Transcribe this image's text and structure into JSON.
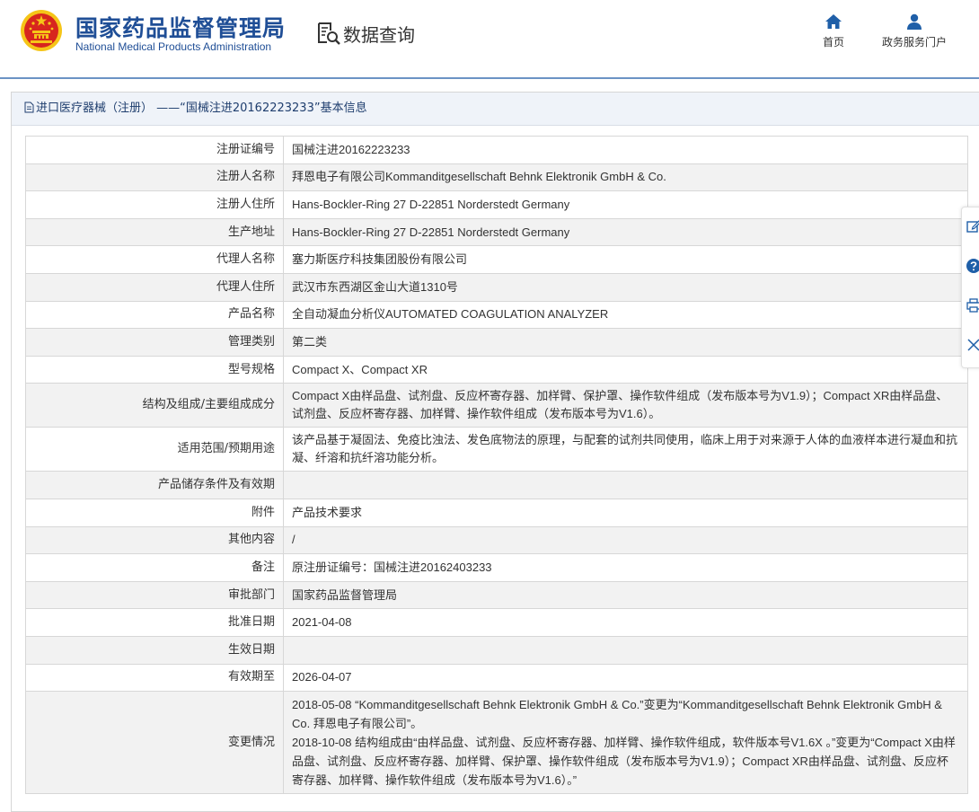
{
  "header": {
    "brand_cn": "国家药品监督管理局",
    "brand_en": "National Medical Products Administration",
    "data_query_label": "数据查询",
    "nav": [
      {
        "label": "首页",
        "icon": "home-icon"
      },
      {
        "label": "政务服务门户",
        "icon": "user-icon"
      }
    ]
  },
  "panel": {
    "title": "进口医疗器械（注册） ——“国械注进20162223233”基本信息"
  },
  "rows": [
    {
      "label": "注册证编号",
      "value": "国械注进20162223233"
    },
    {
      "label": "注册人名称",
      "value": "拜恩电子有限公司Kommanditgesellschaft Behnk Elektronik GmbH & Co."
    },
    {
      "label": "注册人住所",
      "value": "Hans-Bockler-Ring 27 D-22851 Norderstedt Germany"
    },
    {
      "label": "生产地址",
      "value": "Hans-Bockler-Ring 27 D-22851 Norderstedt Germany"
    },
    {
      "label": "代理人名称",
      "value": "塞力斯医疗科技集团股份有限公司"
    },
    {
      "label": "代理人住所",
      "value": "武汉市东西湖区金山大道1310号"
    },
    {
      "label": "产品名称",
      "value": "全自动凝血分析仪AUTOMATED COAGULATION ANALYZER"
    },
    {
      "label": "管理类别",
      "value": "第二类"
    },
    {
      "label": "型号规格",
      "value": "Compact X、Compact XR"
    },
    {
      "label": "结构及组成/主要组成成分",
      "value": "Compact X由样品盘、试剂盘、反应杯寄存器、加样臂、保护罩、操作软件组成（发布版本号为V1.9）；Compact XR由样品盘、试剂盘、反应杯寄存器、加样臂、操作软件组成（发布版本号为V1.6）。"
    },
    {
      "label": "适用范围/预期用途",
      "value": "该产品基于凝固法、免疫比浊法、发色底物法的原理，与配套的试剂共同使用，临床上用于对来源于人体的血液样本进行凝血和抗凝、纤溶和抗纤溶功能分析。"
    },
    {
      "label": "产品储存条件及有效期",
      "value": ""
    },
    {
      "label": "附件",
      "value": "产品技术要求"
    },
    {
      "label": "其他内容",
      "value": "/"
    },
    {
      "label": "备注",
      "value": "原注册证编号：国械注进20162403233"
    },
    {
      "label": "审批部门",
      "value": "国家药品监督管理局"
    },
    {
      "label": "批准日期",
      "value": "2021-04-08"
    },
    {
      "label": "生效日期",
      "value": ""
    },
    {
      "label": "有效期至",
      "value": "2026-04-07"
    }
  ],
  "change": {
    "label": "变更情况",
    "lines": [
      "2018-05-08 “Kommanditgesellschaft Behnk Elektronik GmbH & Co.”变更为“Kommanditgesellschaft Behnk Elektronik GmbH & Co. 拜恩电子有限公司”。",
      "2018-10-08 结构组成由“由样品盘、试剂盘、反应杯寄存器、加样臂、操作软件组成，软件版本号V1.6X 。”变更为“Compact X由样品盘、试剂盘、反应杯寄存器、加样臂、保护罩、操作软件组成（发布版本号为V1.9）；Compact XR由样品盘、试剂盘、反应杯寄存器、加样臂、操作软件组成（发布版本号为V1.6）。”"
    ]
  },
  "float_bar": {
    "icons": [
      "edit-icon",
      "help-icon",
      "print-icon",
      "close-icon"
    ]
  },
  "colors": {
    "brand": "#1f4e96",
    "header_rule": "#6b93c5",
    "nav_icon": "#1f5fa8",
    "panel_title_bg": "#eff3f9",
    "row_alt_bg": "#f2f2f2",
    "emblem_red": "#d7261e",
    "emblem_gold": "#f5c518"
  }
}
